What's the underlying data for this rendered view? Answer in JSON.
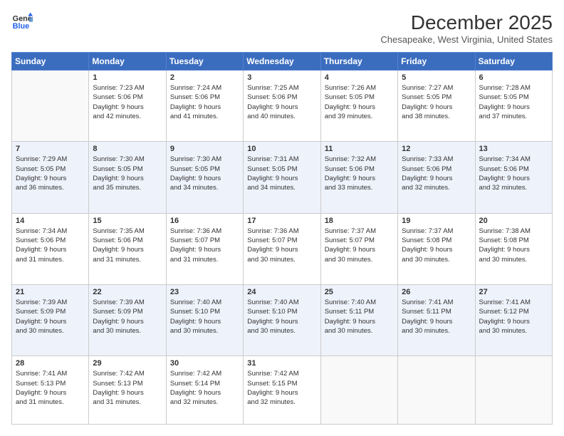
{
  "logo": {
    "line1": "General",
    "line2": "Blue"
  },
  "title": "December 2025",
  "subtitle": "Chesapeake, West Virginia, United States",
  "days_header": [
    "Sunday",
    "Monday",
    "Tuesday",
    "Wednesday",
    "Thursday",
    "Friday",
    "Saturday"
  ],
  "weeks": [
    [
      {
        "num": "",
        "info": ""
      },
      {
        "num": "1",
        "info": "Sunrise: 7:23 AM\nSunset: 5:06 PM\nDaylight: 9 hours\nand 42 minutes."
      },
      {
        "num": "2",
        "info": "Sunrise: 7:24 AM\nSunset: 5:06 PM\nDaylight: 9 hours\nand 41 minutes."
      },
      {
        "num": "3",
        "info": "Sunrise: 7:25 AM\nSunset: 5:06 PM\nDaylight: 9 hours\nand 40 minutes."
      },
      {
        "num": "4",
        "info": "Sunrise: 7:26 AM\nSunset: 5:05 PM\nDaylight: 9 hours\nand 39 minutes."
      },
      {
        "num": "5",
        "info": "Sunrise: 7:27 AM\nSunset: 5:05 PM\nDaylight: 9 hours\nand 38 minutes."
      },
      {
        "num": "6",
        "info": "Sunrise: 7:28 AM\nSunset: 5:05 PM\nDaylight: 9 hours\nand 37 minutes."
      }
    ],
    [
      {
        "num": "7",
        "info": "Sunrise: 7:29 AM\nSunset: 5:05 PM\nDaylight: 9 hours\nand 36 minutes."
      },
      {
        "num": "8",
        "info": "Sunrise: 7:30 AM\nSunset: 5:05 PM\nDaylight: 9 hours\nand 35 minutes."
      },
      {
        "num": "9",
        "info": "Sunrise: 7:30 AM\nSunset: 5:05 PM\nDaylight: 9 hours\nand 34 minutes."
      },
      {
        "num": "10",
        "info": "Sunrise: 7:31 AM\nSunset: 5:05 PM\nDaylight: 9 hours\nand 34 minutes."
      },
      {
        "num": "11",
        "info": "Sunrise: 7:32 AM\nSunset: 5:06 PM\nDaylight: 9 hours\nand 33 minutes."
      },
      {
        "num": "12",
        "info": "Sunrise: 7:33 AM\nSunset: 5:06 PM\nDaylight: 9 hours\nand 32 minutes."
      },
      {
        "num": "13",
        "info": "Sunrise: 7:34 AM\nSunset: 5:06 PM\nDaylight: 9 hours\nand 32 minutes."
      }
    ],
    [
      {
        "num": "14",
        "info": "Sunrise: 7:34 AM\nSunset: 5:06 PM\nDaylight: 9 hours\nand 31 minutes."
      },
      {
        "num": "15",
        "info": "Sunrise: 7:35 AM\nSunset: 5:06 PM\nDaylight: 9 hours\nand 31 minutes."
      },
      {
        "num": "16",
        "info": "Sunrise: 7:36 AM\nSunset: 5:07 PM\nDaylight: 9 hours\nand 31 minutes."
      },
      {
        "num": "17",
        "info": "Sunrise: 7:36 AM\nSunset: 5:07 PM\nDaylight: 9 hours\nand 30 minutes."
      },
      {
        "num": "18",
        "info": "Sunrise: 7:37 AM\nSunset: 5:07 PM\nDaylight: 9 hours\nand 30 minutes."
      },
      {
        "num": "19",
        "info": "Sunrise: 7:37 AM\nSunset: 5:08 PM\nDaylight: 9 hours\nand 30 minutes."
      },
      {
        "num": "20",
        "info": "Sunrise: 7:38 AM\nSunset: 5:08 PM\nDaylight: 9 hours\nand 30 minutes."
      }
    ],
    [
      {
        "num": "21",
        "info": "Sunrise: 7:39 AM\nSunset: 5:09 PM\nDaylight: 9 hours\nand 30 minutes."
      },
      {
        "num": "22",
        "info": "Sunrise: 7:39 AM\nSunset: 5:09 PM\nDaylight: 9 hours\nand 30 minutes."
      },
      {
        "num": "23",
        "info": "Sunrise: 7:40 AM\nSunset: 5:10 PM\nDaylight: 9 hours\nand 30 minutes."
      },
      {
        "num": "24",
        "info": "Sunrise: 7:40 AM\nSunset: 5:10 PM\nDaylight: 9 hours\nand 30 minutes."
      },
      {
        "num": "25",
        "info": "Sunrise: 7:40 AM\nSunset: 5:11 PM\nDaylight: 9 hours\nand 30 minutes."
      },
      {
        "num": "26",
        "info": "Sunrise: 7:41 AM\nSunset: 5:11 PM\nDaylight: 9 hours\nand 30 minutes."
      },
      {
        "num": "27",
        "info": "Sunrise: 7:41 AM\nSunset: 5:12 PM\nDaylight: 9 hours\nand 30 minutes."
      }
    ],
    [
      {
        "num": "28",
        "info": "Sunrise: 7:41 AM\nSunset: 5:13 PM\nDaylight: 9 hours\nand 31 minutes."
      },
      {
        "num": "29",
        "info": "Sunrise: 7:42 AM\nSunset: 5:13 PM\nDaylight: 9 hours\nand 31 minutes."
      },
      {
        "num": "30",
        "info": "Sunrise: 7:42 AM\nSunset: 5:14 PM\nDaylight: 9 hours\nand 32 minutes."
      },
      {
        "num": "31",
        "info": "Sunrise: 7:42 AM\nSunset: 5:15 PM\nDaylight: 9 hours\nand 32 minutes."
      },
      {
        "num": "",
        "info": ""
      },
      {
        "num": "",
        "info": ""
      },
      {
        "num": "",
        "info": ""
      }
    ]
  ]
}
